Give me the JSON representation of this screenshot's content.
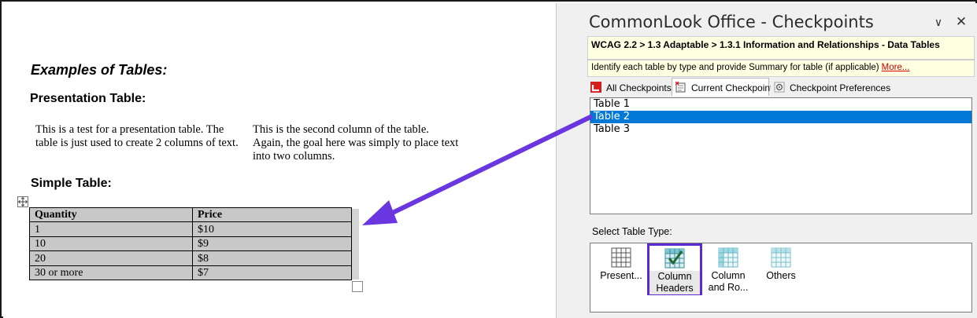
{
  "document": {
    "heading_examples": "Examples of Tables:",
    "heading_presentation": "Presentation Table:",
    "presentation_col1": "This is a test for a presentation table. The table is just used to create 2 columns of text.",
    "presentation_col2": "This is the second column of the table. Again, the goal here was simply to place text into two columns.",
    "heading_simple": "Simple Table:",
    "simple_table": {
      "headers": [
        "Quantity",
        "Price"
      ],
      "rows": [
        [
          "1",
          "$10"
        ],
        [
          "10",
          "$9"
        ],
        [
          "20",
          "$8"
        ],
        [
          "30 or more",
          "$7"
        ]
      ]
    }
  },
  "panel": {
    "title": "CommonLook Office - Checkpoints",
    "collapse_glyph": "∨",
    "close_glyph": "✕",
    "breadcrumb": "WCAG 2.2 > 1.3 Adaptable > 1.3.1 Information and Relationships - Data Tables",
    "description": "Identify each table by type and provide Summary for table (if applicable)",
    "description_more": "More...",
    "tabs": [
      {
        "label": "All Checkpoints",
        "icon": "all-checkpoints-icon"
      },
      {
        "label": "Current Checkpoint",
        "icon": "current-checkpoint-icon",
        "active": true
      },
      {
        "label": "Checkpoint Preferences",
        "icon": "gear-icon"
      }
    ],
    "tables": [
      "Table 1",
      "Table 2",
      "Table 3"
    ],
    "selected_table": "Table 2",
    "select_type_label": "Select Table Type:",
    "table_types": [
      {
        "line1": "Present...",
        "line2": "",
        "icon": "presentation-table-icon"
      },
      {
        "line1": "Column",
        "line2": "Headers",
        "icon": "column-headers-icon",
        "selected": true
      },
      {
        "line1": "Column",
        "line2": "and Ro...",
        "icon": "column-row-headers-icon"
      },
      {
        "line1": "Others",
        "line2": "",
        "icon": "other-table-icon"
      }
    ]
  },
  "colors": {
    "selection_blue": "#0078d7",
    "highlight_purple": "#5b2bd1",
    "tooltip_yellow": "#ffffe1",
    "table_gray": "#c8c8c8"
  }
}
